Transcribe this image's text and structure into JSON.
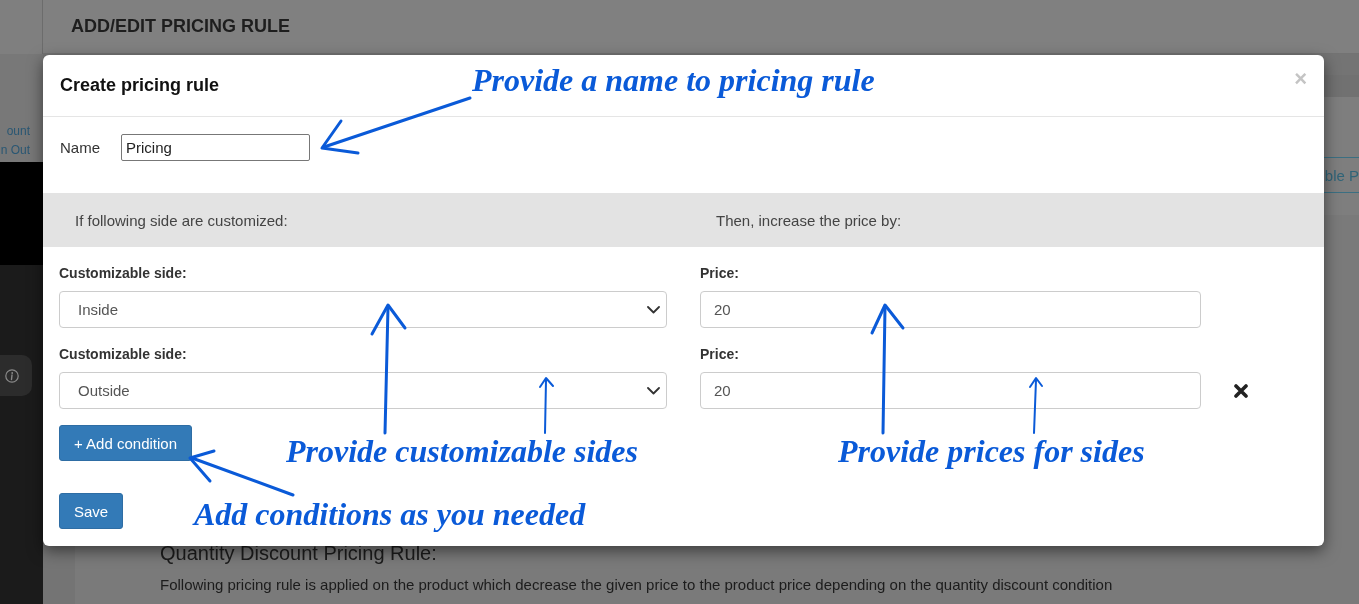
{
  "page": {
    "title": "ADD/EDIT PRICING RULE",
    "sidebar_links": [
      {
        "label": "ount"
      },
      {
        "label": "n Out"
      }
    ],
    "tab_button": "ble P",
    "section_heading": "Quantity Discount Pricing Rule:",
    "section_text": "Following pricing rule is applied on the product which decrease the given price to the product price depending on the quantity discount condition"
  },
  "dialog": {
    "title": "Create pricing rule",
    "close": "×",
    "name": {
      "label": "Name",
      "value": "Pricing"
    },
    "band": [
      "If following side are customized:",
      "Then, increase the price by:"
    ],
    "conditions": [
      {
        "side_label": "Customizable side:",
        "side": "Inside",
        "price_label": "Price:",
        "price": "20",
        "removable": false
      },
      {
        "side_label": "Customizable side:",
        "side": "Outside",
        "price_label": "Price:",
        "price": "20",
        "removable": true
      }
    ],
    "buttons": [
      {
        "kind": "add",
        "label": "+ Add condition"
      },
      {
        "kind": "save",
        "label": "Save"
      }
    ]
  },
  "annotations": [
    {
      "text": "Provide a name to pricing rule"
    },
    {
      "text": "Provide customizable sides"
    },
    {
      "text": "Provide prices for sides"
    },
    {
      "text": "Add conditions as you needed"
    }
  ]
}
